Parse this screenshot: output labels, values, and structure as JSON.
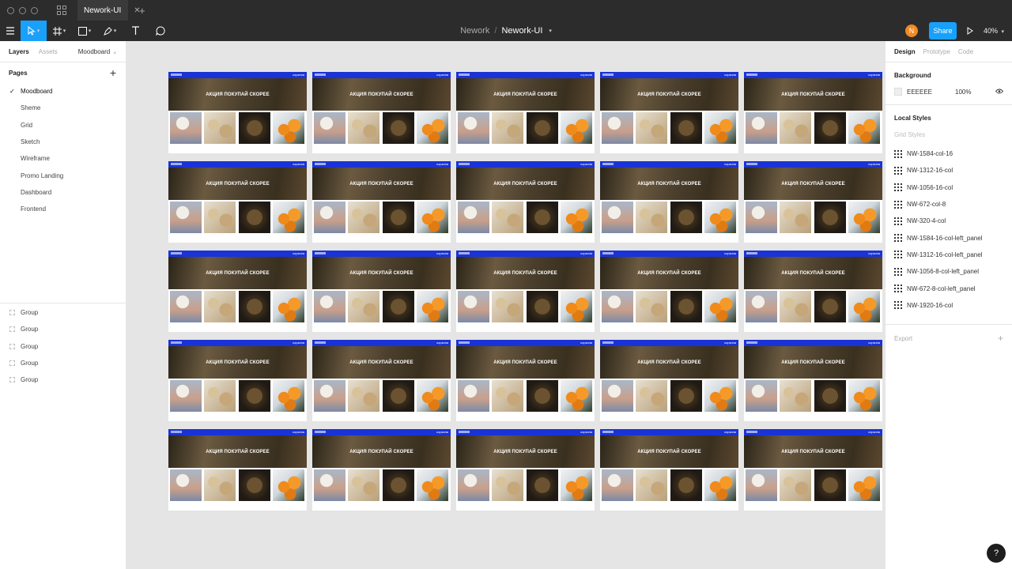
{
  "tabbar": {
    "tab_label": "Nework-UI",
    "close": "✕",
    "add": "+"
  },
  "toolbar": {
    "project": "Nework",
    "separator": "/",
    "file": "Nework-UI",
    "avatar_initial": "N",
    "share_label": "Share",
    "zoom": "40%"
  },
  "left_panel": {
    "tabs": {
      "layers": "Layers",
      "assets": "Assets",
      "page_select": "Moodboard"
    },
    "pages_title": "Pages",
    "add": "+",
    "pages": [
      {
        "label": "Moodboard",
        "selected": true
      },
      {
        "label": "Sheme"
      },
      {
        "label": "Grid"
      },
      {
        "label": "Sketch"
      },
      {
        "label": "Wireframe"
      },
      {
        "label": "Promo Landing"
      },
      {
        "label": "Dashboard"
      },
      {
        "label": "Frontend"
      }
    ],
    "layers": [
      "Group",
      "Group",
      "Group",
      "Group",
      "Group"
    ]
  },
  "frame_template": {
    "cart_label": "корзина",
    "hero_text": "АКЦИЯ ПОКУПАЙ СКОРЕЕ",
    "nav_color": "#1a33d6"
  },
  "right_panel": {
    "tabs": {
      "design": "Design",
      "prototype": "Prototype",
      "code": "Code"
    },
    "background_title": "Background",
    "background_hex": "EEEEEE",
    "background_opacity": "100%",
    "local_styles_title": "Local Styles",
    "grid_styles_label": "Grid Styles",
    "grid_styles": [
      "NW-1584-col-16",
      "NW-1312-16-col",
      "NW-1056-16-col",
      "NW-672-col-8",
      "NW-320-4-col",
      "NW-1584-16-col-left_panel",
      "NW-1312-16-col-left_panel",
      "NW-1056-8-col-left_panel",
      "NW-672-8-col-left_panel",
      "NW-1920-16-col"
    ],
    "export_label": "Export",
    "export_add": "+"
  },
  "help": "?",
  "colors": {
    "accent": "#18a0fb",
    "toolbar_bg": "#2c2c2c",
    "canvas_bg": "#e5e5e5",
    "avatar": "#f08a24"
  }
}
